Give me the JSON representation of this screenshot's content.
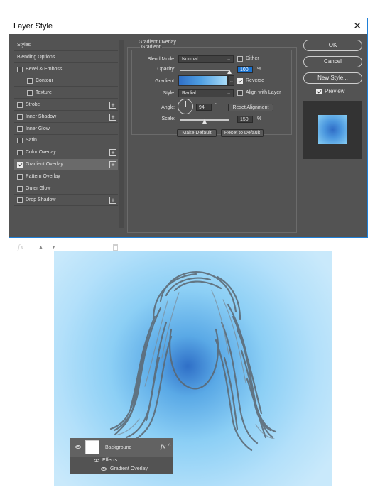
{
  "dialog": {
    "title": "Layer Style",
    "close_glyph": "✕",
    "styles_list": [
      {
        "label": "Styles",
        "checkbox": false,
        "checked": false,
        "plus": false,
        "indent": 0,
        "selected": false
      },
      {
        "label": "Blending Options",
        "checkbox": false,
        "checked": false,
        "plus": false,
        "indent": 0,
        "selected": false
      },
      {
        "label": "Bevel & Emboss",
        "checkbox": true,
        "checked": false,
        "plus": false,
        "indent": 0,
        "selected": false
      },
      {
        "label": "Contour",
        "checkbox": true,
        "checked": false,
        "plus": false,
        "indent": 1,
        "selected": false
      },
      {
        "label": "Texture",
        "checkbox": true,
        "checked": false,
        "plus": false,
        "indent": 1,
        "selected": false
      },
      {
        "label": "Stroke",
        "checkbox": true,
        "checked": false,
        "plus": true,
        "indent": 0,
        "selected": false
      },
      {
        "label": "Inner Shadow",
        "checkbox": true,
        "checked": false,
        "plus": true,
        "indent": 0,
        "selected": false
      },
      {
        "label": "Inner Glow",
        "checkbox": true,
        "checked": false,
        "plus": false,
        "indent": 0,
        "selected": false
      },
      {
        "label": "Satin",
        "checkbox": true,
        "checked": false,
        "plus": false,
        "indent": 0,
        "selected": false
      },
      {
        "label": "Color Overlay",
        "checkbox": true,
        "checked": false,
        "plus": true,
        "indent": 0,
        "selected": false
      },
      {
        "label": "Gradient Overlay",
        "checkbox": true,
        "checked": true,
        "plus": true,
        "indent": 0,
        "selected": true
      },
      {
        "label": "Pattern Overlay",
        "checkbox": true,
        "checked": false,
        "plus": false,
        "indent": 0,
        "selected": false
      },
      {
        "label": "Outer Glow",
        "checkbox": true,
        "checked": false,
        "plus": false,
        "indent": 0,
        "selected": false
      },
      {
        "label": "Drop Shadow",
        "checkbox": true,
        "checked": false,
        "plus": true,
        "indent": 0,
        "selected": false
      }
    ],
    "plus_glyph": "+",
    "footer": {
      "fx": "fx",
      "up": "▲",
      "down": "▼",
      "trash": "🗑"
    },
    "section_title": "Gradient Overlay",
    "group_title": "Gradient",
    "blend_mode": {
      "label": "Blend Mode:",
      "value": "Normal"
    },
    "dither": {
      "label": "Dither",
      "checked": false
    },
    "opacity": {
      "label": "Opacity:",
      "value": "100",
      "unit": "%",
      "level": 1.0
    },
    "gradient": {
      "label": "Gradient:"
    },
    "reverse": {
      "label": "Reverse",
      "checked": true
    },
    "style": {
      "label": "Style:",
      "value": "Radial"
    },
    "align_with_layer": {
      "label": "Align with Layer",
      "checked": false
    },
    "angle": {
      "label": "Angle:",
      "value": "94",
      "unit": "°"
    },
    "reset_alignment": "Reset Alignment",
    "scale": {
      "label": "Scale:",
      "value": "150",
      "unit": "%",
      "level": 0.5
    },
    "make_default": "Make Default",
    "reset_to_default": "Reset to Default",
    "ok": "OK",
    "cancel": "Cancel",
    "new_style": "New Style...",
    "preview": {
      "label": "Preview",
      "checked": true
    }
  },
  "layers": {
    "layer_name": "Background",
    "fx": "fx",
    "effects_label": "Effects",
    "effect_item": "Gradient Overlay"
  },
  "colors": {
    "dialog_bg": "#535353",
    "gradient_dark": "#2f6fc7",
    "gradient_light": "#c9e9fb",
    "selection_blue": "#1a73d1"
  }
}
